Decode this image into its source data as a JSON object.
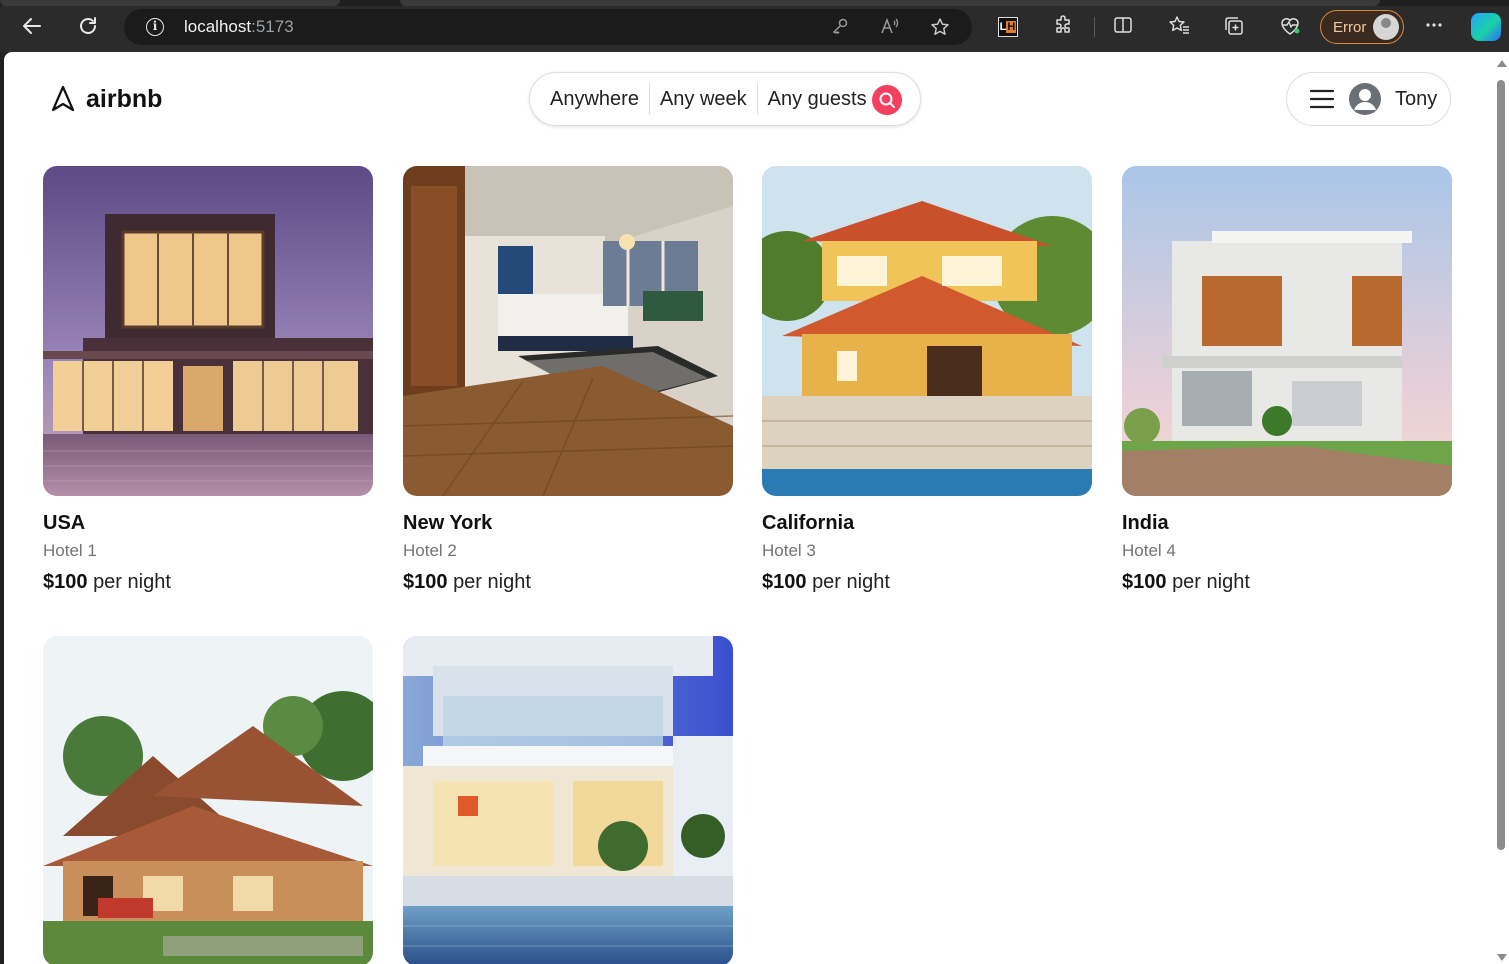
{
  "browser": {
    "url_host": "localhost",
    "url_port": ":5173",
    "profile_status": "Error",
    "icons": [
      "back-icon",
      "refresh-icon",
      "info-icon",
      "key-icon",
      "read-aloud-icon",
      "favorite-star-icon",
      "lighthouse-icon",
      "extensions-icon",
      "split-screen-icon",
      "favorites-icon",
      "collections-icon",
      "performance-icon",
      "more-icon",
      "copilot-icon"
    ]
  },
  "header": {
    "logo_text": "airbnb",
    "search": {
      "where": "Anywhere",
      "when": "Any week",
      "who": "Any guests"
    },
    "user_name": "Tony",
    "accent_color": "#f43f5e"
  },
  "listings": [
    {
      "location": "USA",
      "name": "Hotel 1",
      "price": "$100",
      "price_suffix": "per night"
    },
    {
      "location": "New York",
      "name": "Hotel 2",
      "price": "$100",
      "price_suffix": "per night"
    },
    {
      "location": "California",
      "name": "Hotel 3",
      "price": "$100",
      "price_suffix": "per night"
    },
    {
      "location": "India",
      "name": "Hotel 4",
      "price": "$100",
      "price_suffix": "per night"
    },
    {
      "location": "",
      "name": "",
      "price": "",
      "price_suffix": ""
    },
    {
      "location": "",
      "name": "",
      "price": "",
      "price_suffix": ""
    }
  ]
}
